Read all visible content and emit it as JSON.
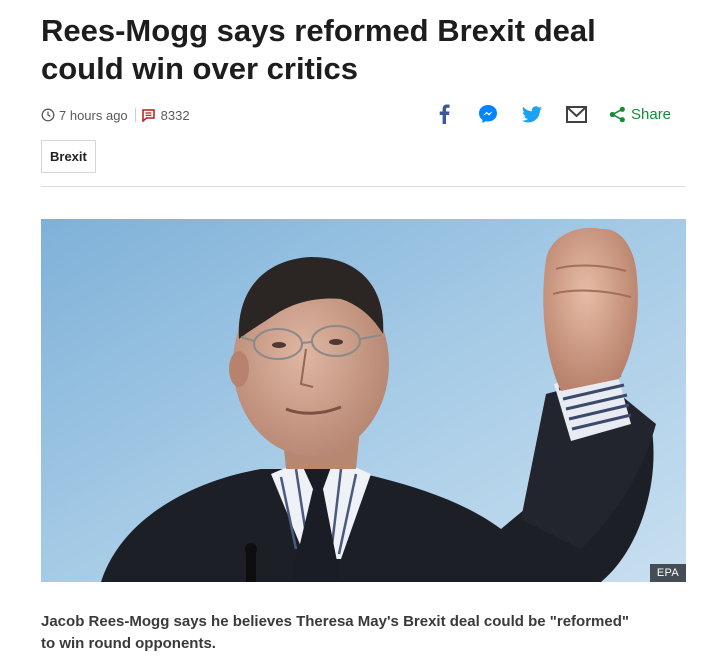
{
  "article": {
    "headline": "Rees-Mogg says reformed Brexit deal could win over critics",
    "timestamp": "7 hours ago",
    "comment_count": "8332",
    "tag": "Brexit",
    "image_credit": "EPA",
    "summary": "Jacob Rees-Mogg says he believes Theresa May's Brexit deal could be \"reformed\" to win round opponents."
  },
  "share": {
    "label": "Share",
    "icons": [
      "facebook-icon",
      "messenger-icon",
      "twitter-icon",
      "email-icon",
      "share-icon"
    ]
  },
  "colors": {
    "facebook": "#3b5998",
    "messenger": "#0084ff",
    "twitter": "#1da1f2",
    "email": "#404040",
    "share": "#1a8a3a",
    "comment": "#bb1919"
  }
}
